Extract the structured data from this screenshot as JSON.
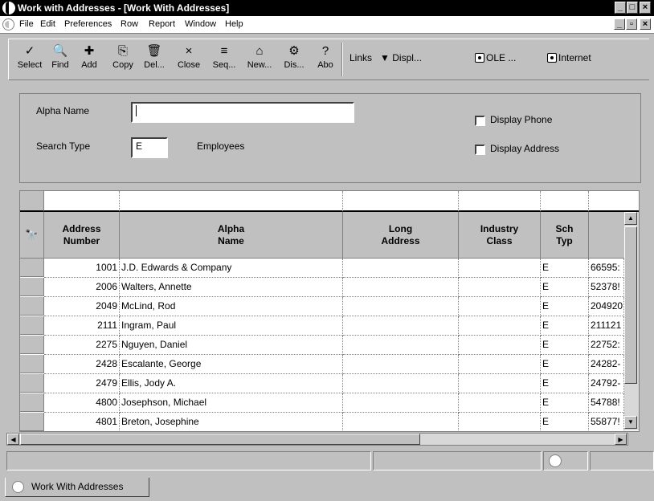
{
  "window": {
    "title": "Work with Addresses - [Work With Addresses]",
    "controls": [
      "_",
      "□",
      "×"
    ],
    "mdi_controls": [
      "_",
      "▫",
      "×"
    ]
  },
  "menu": [
    "File",
    "Edit",
    "Preferences",
    "Row",
    "Report",
    "Window",
    "Help"
  ],
  "toolbar": {
    "buttons": [
      {
        "icon": "✓",
        "label": "Select"
      },
      {
        "icon": "🔍",
        "label": "Find"
      },
      {
        "icon": "✚",
        "label": "Add"
      },
      {
        "icon": "⎘",
        "label": "Copy"
      },
      {
        "icon": "🗑",
        "label": "Del..."
      },
      {
        "icon": "×",
        "label": "Close"
      },
      {
        "icon": "≡",
        "label": "Seq..."
      },
      {
        "icon": "⌂",
        "label": "New..."
      },
      {
        "icon": "⚙",
        "label": "Dis..."
      },
      {
        "icon": "?",
        "label": "Abo"
      }
    ],
    "links_label": "Links",
    "display_label": "Displ...",
    "ole_label": "OLE ...",
    "internet_label": "Internet"
  },
  "form": {
    "alpha_name_label": "Alpha Name",
    "alpha_name_value": "",
    "search_type_label": "Search Type",
    "search_type_value": "E",
    "search_type_desc": "Employees",
    "display_phone_label": "Display Phone",
    "display_phone_checked": false,
    "display_address_label": "Display Address",
    "display_address_checked": false
  },
  "grid": {
    "headers": {
      "address_number": "Address\nNumber",
      "alpha_name": "Alpha\nName",
      "long_address": "Long\nAddress",
      "industry_class": "Industry\nClass",
      "sch_typ": "Sch\nTyp"
    },
    "rows": [
      {
        "number": "1001",
        "name": "J.D. Edwards & Company",
        "long": "",
        "industry": "",
        "sch": "E",
        "extra": "66595:"
      },
      {
        "number": "2006",
        "name": "Walters, Annette",
        "long": "",
        "industry": "",
        "sch": "E",
        "extra": "52378!"
      },
      {
        "number": "2049",
        "name": "McLind, Rod",
        "long": "",
        "industry": "",
        "sch": "E",
        "extra": "204920"
      },
      {
        "number": "2111",
        "name": "Ingram, Paul",
        "long": "",
        "industry": "",
        "sch": "E",
        "extra": "211121"
      },
      {
        "number": "2275",
        "name": "Nguyen, Daniel",
        "long": "",
        "industry": "",
        "sch": "E",
        "extra": "22752:"
      },
      {
        "number": "2428",
        "name": "Escalante, George",
        "long": "",
        "industry": "",
        "sch": "E",
        "extra": "24282-"
      },
      {
        "number": "2479",
        "name": "Ellis, Jody A.",
        "long": "",
        "industry": "",
        "sch": "E",
        "extra": "24792-"
      },
      {
        "number": "4800",
        "name": "Josephson, Michael",
        "long": "",
        "industry": "",
        "sch": "E",
        "extra": "54788!"
      },
      {
        "number": "4801",
        "name": "Breton, Josephine",
        "long": "",
        "industry": "",
        "sch": "E",
        "extra": "55877!"
      }
    ]
  },
  "tab": {
    "label": "Work With Addresses"
  }
}
